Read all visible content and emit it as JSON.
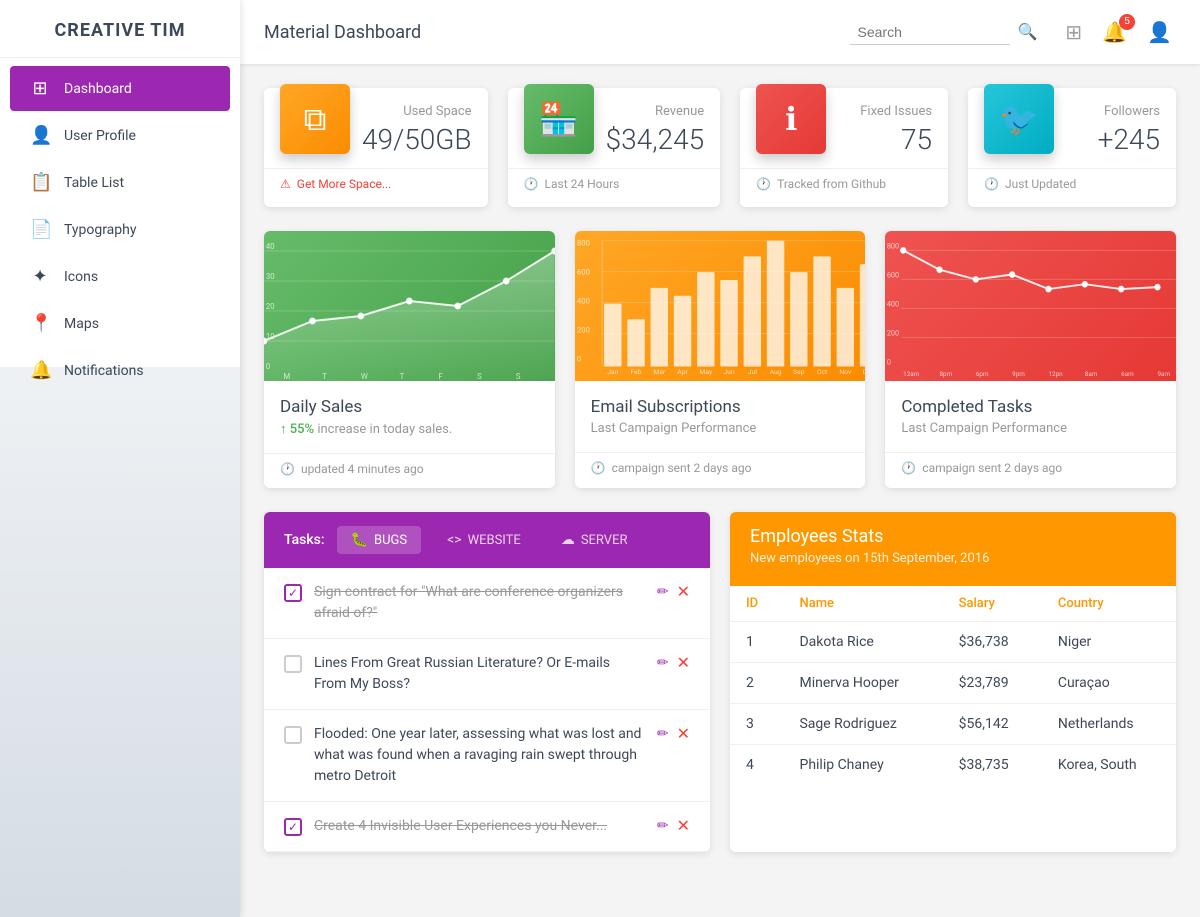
{
  "sidebar": {
    "brand": "CREATIVE TIM",
    "items": [
      {
        "id": "dashboard",
        "label": "Dashboard",
        "icon": "⊞",
        "active": true
      },
      {
        "id": "user-profile",
        "label": "User Profile",
        "icon": "👤",
        "active": false
      },
      {
        "id": "table-list",
        "label": "Table List",
        "icon": "📋",
        "active": false
      },
      {
        "id": "typography",
        "label": "Typography",
        "icon": "📄",
        "active": false
      },
      {
        "id": "icons",
        "label": "Icons",
        "icon": "✦",
        "active": false
      },
      {
        "id": "maps",
        "label": "Maps",
        "icon": "📍",
        "active": false
      },
      {
        "id": "notifications",
        "label": "Notifications",
        "icon": "🔔",
        "active": false
      }
    ]
  },
  "header": {
    "title": "Material Dashboard",
    "search_placeholder": "Search",
    "notification_count": "5"
  },
  "stats": [
    {
      "id": "used-space",
      "icon": "⧉",
      "icon_class": "stat-icon-orange",
      "label": "Used Space",
      "value": "49/50GB",
      "footer": "Get More Space...",
      "footer_icon": "⚠",
      "footer_type": "warning"
    },
    {
      "id": "revenue",
      "icon": "🏪",
      "icon_class": "stat-icon-green",
      "label": "Revenue",
      "value": "$34,245",
      "footer": "Last 24 Hours",
      "footer_icon": "📅",
      "footer_type": "info"
    },
    {
      "id": "fixed-issues",
      "icon": "ℹ",
      "icon_class": "stat-icon-red",
      "label": "Fixed Issues",
      "value": "75",
      "footer": "Tracked from Github",
      "footer_icon": "🏷",
      "footer_type": "info"
    },
    {
      "id": "followers",
      "icon": "🐦",
      "icon_class": "stat-icon-teal",
      "label": "Followers",
      "value": "+245",
      "footer": "Just Updated",
      "footer_icon": "🕐",
      "footer_type": "info"
    }
  ],
  "charts": [
    {
      "id": "daily-sales",
      "title": "Daily Sales",
      "subtitle_prefix": "55%",
      "subtitle_suffix": " increase in today sales.",
      "footer": "updated 4 minutes ago",
      "color_class": "chart-area-green"
    },
    {
      "id": "email-subscriptions",
      "title": "Email Subscriptions",
      "subtitle": "Last Campaign Performance",
      "footer": "campaign sent 2 days ago",
      "color_class": "chart-area-orange"
    },
    {
      "id": "completed-tasks",
      "title": "Completed Tasks",
      "subtitle": "Last Campaign Performance",
      "footer": "campaign sent 2 days ago",
      "color_class": "chart-area-red"
    }
  ],
  "tasks": {
    "header_label": "Tasks:",
    "tabs": [
      {
        "id": "bugs",
        "label": "BUGS",
        "icon": "🐛",
        "active": true
      },
      {
        "id": "website",
        "label": "WEBSITE",
        "icon": "<>",
        "active": false
      },
      {
        "id": "server",
        "label": "SERVER",
        "icon": "☁",
        "active": false
      }
    ],
    "items": [
      {
        "id": 1,
        "text": "Sign contract for \"What are conference organizers afraid of?\"",
        "done": true
      },
      {
        "id": 2,
        "text": "Lines From Great Russian Literature? Or E-mails From My Boss?",
        "done": false
      },
      {
        "id": 3,
        "text": "Flooded: One year later, assessing what was lost and what was found when a ravaging rain swept through metro Detroit",
        "done": false
      },
      {
        "id": 4,
        "text": "Create 4 Invisible User Experiences you Never...",
        "done": true
      }
    ]
  },
  "employees": {
    "title": "Employees Stats",
    "subtitle": "New employees on 15th September, 2016",
    "columns": [
      "ID",
      "Name",
      "Salary",
      "Country"
    ],
    "rows": [
      {
        "id": "1",
        "name": "Dakota Rice",
        "salary": "$36,738",
        "country": "Niger"
      },
      {
        "id": "2",
        "name": "Minerva Hooper",
        "salary": "$23,789",
        "country": "Curaçao"
      },
      {
        "id": "3",
        "name": "Sage Rodriguez",
        "salary": "$56,142",
        "country": "Netherlands"
      },
      {
        "id": "4",
        "name": "Philip Chaney",
        "salary": "$38,735",
        "country": "Korea, South"
      }
    ]
  }
}
